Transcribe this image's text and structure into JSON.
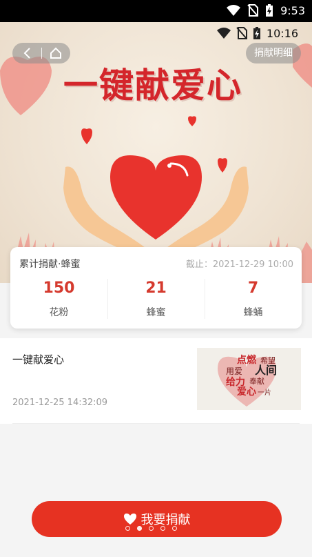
{
  "system_status": {
    "time": "9:53"
  },
  "inner_status": {
    "time": "10:16"
  },
  "header": {
    "detail_button": "捐献明细"
  },
  "banner": {
    "title": "一键献爱心"
  },
  "stats": {
    "label": "累计捐献·蜂蜜",
    "date": "截止：2021-12-29 10:00",
    "items": [
      {
        "value": "150",
        "unit": "花粉"
      },
      {
        "value": "21",
        "unit": "蜂蜜"
      },
      {
        "value": "7",
        "unit": "蜂蛹"
      }
    ]
  },
  "list": [
    {
      "title": "一键献爱心",
      "date": "2021-12-25 14:32:09",
      "thumb_words": [
        "点燃",
        "希望",
        "人间",
        "用爱",
        "给力",
        "奉献",
        "爱心",
        "一片"
      ]
    }
  ],
  "donate": {
    "label": "我要捐献"
  },
  "pager": {
    "count": 5,
    "active": 1
  },
  "colors": {
    "accent": "#e63222",
    "number": "#d53a2e",
    "title": "#d4262b"
  }
}
